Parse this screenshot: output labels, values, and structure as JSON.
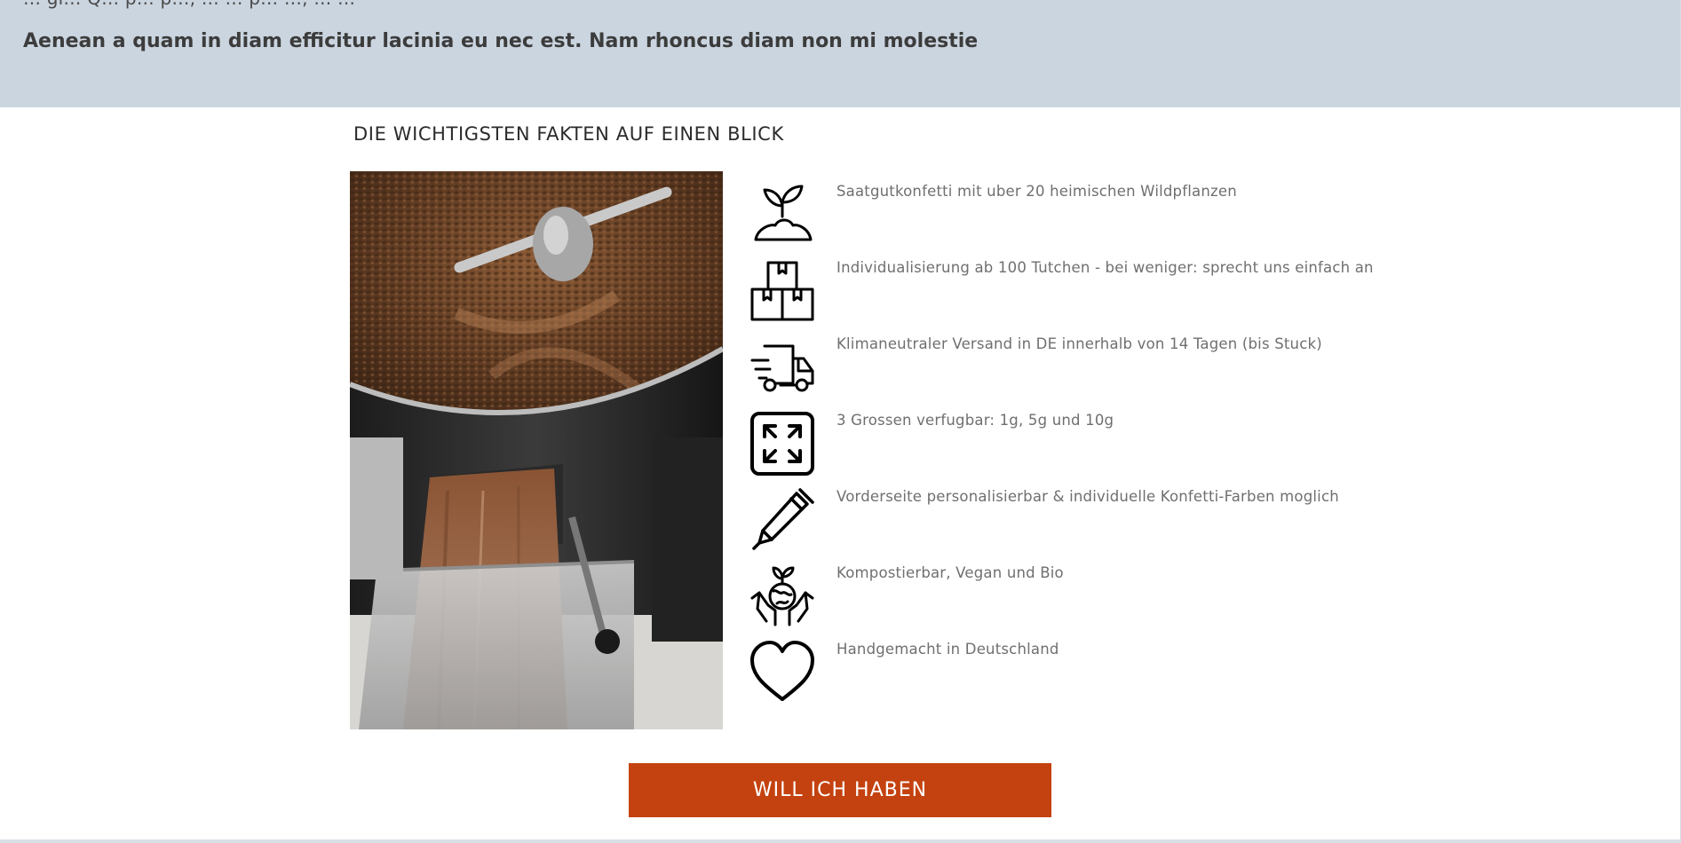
{
  "top": {
    "cut_text": "… gi… Q…  p… p…, … … p… …, … …",
    "subhead": "Aenean a quam in diam efficitur lacinia eu nec est. Nam rhoncus diam non mi molestie",
    "background": "#cbd5e0"
  },
  "facts_section": {
    "title": "DIE WICHTIGSTEN FAKTEN AUF EINEN BLICK",
    "items": [
      {
        "icon": "sprout-icon",
        "text": "Saatgutkonfetti mit uber 20 heimischen Wildpflanzen"
      },
      {
        "icon": "boxes-icon",
        "text": "Individualisierung ab 100 Tutchen - bei weniger: sprecht uns einfach an"
      },
      {
        "icon": "delivery-truck-icon",
        "text": "Klimaneutraler Versand in DE innerhalb von 14 Tagen (bis Stuck)"
      },
      {
        "icon": "expand-arrows-icon",
        "text": "3 Grossen verfugbar: 1g, 5g und 10g"
      },
      {
        "icon": "pen-icon",
        "text": "Vorderseite personalisierbar & individuelle Konfetti-Farben moglich"
      },
      {
        "icon": "hands-globe-icon",
        "text": "Kompostierbar, Vegan und Bio"
      },
      {
        "icon": "heart-icon",
        "text": "Handgemacht in Deutschland"
      }
    ]
  },
  "cta": {
    "label": "WILL ICH HABEN",
    "color": "#c4420f"
  }
}
